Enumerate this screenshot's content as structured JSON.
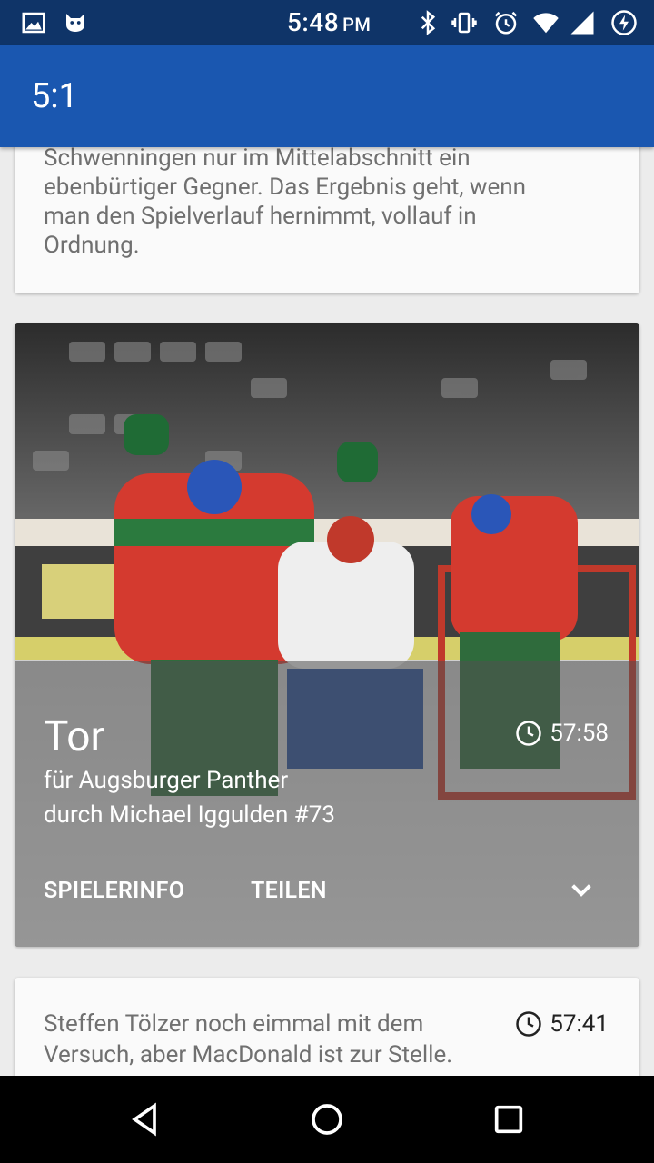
{
  "status_bar": {
    "time": "5:48",
    "ampm": "PM",
    "icons": [
      "image-icon",
      "cat-icon",
      "bluetooth-icon",
      "vibrate-icon",
      "alarm-icon",
      "wifi-icon",
      "signal-icon",
      "battery-charging-icon"
    ]
  },
  "app_bar": {
    "title": "5:1"
  },
  "cards": {
    "prev_text": "Schwenningen nur im Mittelabschnitt ein ebenbürtiger Gegner. Das Ergebnis geht, wenn man den Spielverlauf hernimmt, vollauf in Ordnung.",
    "goal": {
      "title": "Tor",
      "time": "57:58",
      "team_line": "für Augsburger Panther",
      "scorer_line": "durch Michael Iggulden #73",
      "action_playerinfo": "SPIELERINFO",
      "action_share": "TEILEN"
    },
    "next": {
      "text": "Steffen Tölzer noch eimmal mit dem Versuch, aber MacDonald ist zur Stelle.",
      "time": "57:41"
    }
  },
  "nav": [
    "back-icon",
    "home-icon",
    "recents-icon"
  ]
}
